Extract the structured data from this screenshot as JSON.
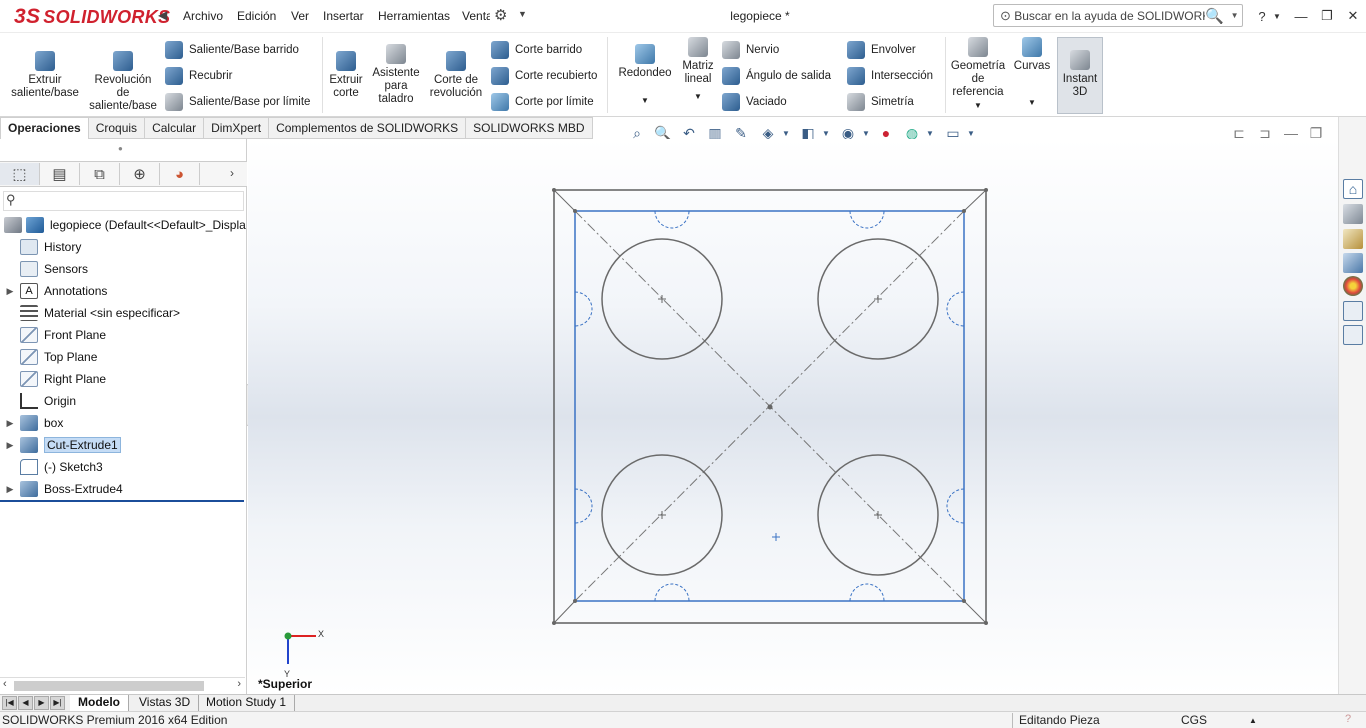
{
  "app": {
    "logo_ds": "3S",
    "logo_text": "SOLIDWORKS",
    "document_title": "legopiece *",
    "search_placeholder": "Buscar en la ayuda de SOLIDWORKS",
    "help_label": "?"
  },
  "menu": [
    "Archivo",
    "Edición",
    "Ver",
    "Insertar",
    "Herramientas",
    "Ventana"
  ],
  "ribbon": {
    "extrude": "Extruir\nsaliente/base",
    "revolve": "Revolución\nde\nsaliente/base",
    "swept_boss": "Saliente/Base barrido",
    "loft_boss": "Recubrir",
    "boundary_boss": "Saliente/Base por límite",
    "extruded_cut": "Extruir\ncorte",
    "hole_wizard": "Asistente\npara\ntaladro",
    "revolved_cut": "Corte de\nrevolución",
    "swept_cut": "Corte barrido",
    "lofted_cut": "Corte recubierto",
    "boundary_cut": "Corte por límite",
    "fillet": "Redondeo",
    "linear_pattern": "Matriz\nlineal",
    "rib": "Nervio",
    "draft": "Ángulo de salida",
    "shell": "Vaciado",
    "wrap": "Envolver",
    "intersect": "Intersección",
    "mirror": "Simetría",
    "ref_geometry": "Geometría\nde\nreferencia",
    "curves": "Curvas",
    "instant3d": "Instant\n3D"
  },
  "tabs": [
    "Operaciones",
    "Croquis",
    "Calcular",
    "DimXpert",
    "Complementos de SOLIDWORKS",
    "SOLIDWORKS MBD"
  ],
  "tree": {
    "root": "legopiece  (Default<<Default>_Displa",
    "items": [
      {
        "label": "History"
      },
      {
        "label": "Sensors"
      },
      {
        "label": "Annotations"
      },
      {
        "label": "Material <sin especificar>"
      },
      {
        "label": "Front Plane"
      },
      {
        "label": "Top Plane"
      },
      {
        "label": "Right Plane"
      },
      {
        "label": "Origin"
      },
      {
        "label": "box"
      },
      {
        "label": "Cut-Extrude1"
      },
      {
        "label": "(-) Sketch3"
      },
      {
        "label": "Boss-Extrude4"
      }
    ]
  },
  "graphics": {
    "view_label": "*Superior",
    "axis_x": "X",
    "axis_y": "Y"
  },
  "bottom_tabs": [
    "Modelo",
    "Vistas 3D",
    "Motion Study 1"
  ],
  "status": {
    "edition": "SOLIDWORKS Premium 2016 x64 Edition",
    "mode": "Editando Pieza",
    "units": "CGS"
  },
  "colors": {
    "brand": "#d0212e",
    "sketch_blue": "#3a72c4",
    "model_edge": "#5a5a5a",
    "selection": "#c5dcf5"
  }
}
